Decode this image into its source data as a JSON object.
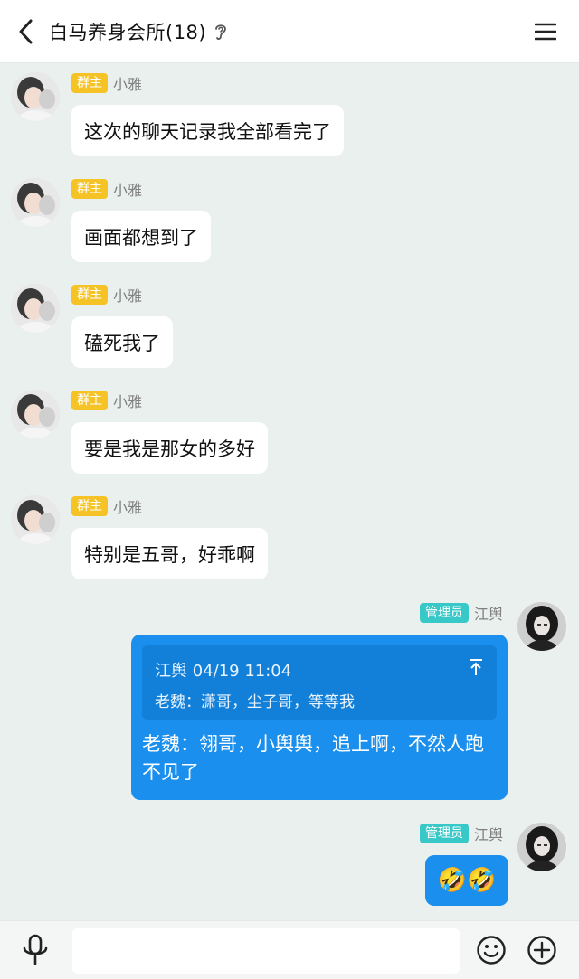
{
  "header": {
    "title": "白马养身会所(18)"
  },
  "messages": [
    {
      "badge": "群主",
      "sender": "小雅",
      "text": "这次的聊天记录我全部看完了"
    },
    {
      "badge": "群主",
      "sender": "小雅",
      "text": "画面都想到了"
    },
    {
      "badge": "群主",
      "sender": "小雅",
      "text": "磕死我了"
    },
    {
      "badge": "群主",
      "sender": "小雅",
      "text": "要是我是那女的多好"
    },
    {
      "badge": "群主",
      "sender": "小雅",
      "text": "特别是五哥，好乖啊"
    }
  ],
  "reply_message": {
    "badge": "管理员",
    "sender": "江舆",
    "quote_head": "江舆 04/19 11:04",
    "quote_body": "老魏：潇哥，尘子哥，等等我",
    "text": "老魏：翎哥，小舆舆，追上啊，不然人跑不见了"
  },
  "emoji_message": {
    "badge": "管理员",
    "sender": "江舆",
    "emojis": "🤣🤣"
  },
  "colors": {
    "owner_badge": "#f6c327",
    "admin_badge": "#38c8c8",
    "self_bubble": "#1a8fee",
    "background": "#eaf0ee"
  },
  "icons": {
    "back": "chevron-left-icon",
    "ear": "ear-icon",
    "menu": "hamburger-menu-icon",
    "pin": "pin-top-icon",
    "voice": "microphone-icon",
    "emoji": "smiley-icon",
    "plus": "plus-circle-icon"
  }
}
